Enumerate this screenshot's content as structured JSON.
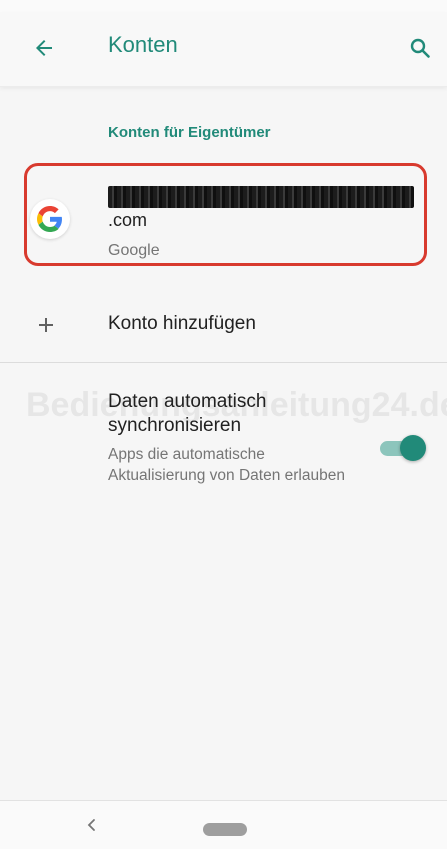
{
  "appbar": {
    "title": "Konten",
    "back_icon": "arrow-left-icon",
    "search_icon": "search-icon"
  },
  "section": {
    "header": "Konten für Eigentümer"
  },
  "account": {
    "icon": "google-logo-icon",
    "email_suffix": ".com",
    "type": "Google"
  },
  "add_account": {
    "icon": "plus-icon",
    "label": "Konto hinzufügen"
  },
  "auto_sync": {
    "title": "Daten automatisch synchronisieren",
    "summary": "Apps die automatische Aktualisierung von Daten erlauben",
    "enabled": true
  },
  "watermark": "Bedienungsanleitung24.de",
  "colors": {
    "accent": "#218a79",
    "highlight_border": "#d83a2e"
  }
}
